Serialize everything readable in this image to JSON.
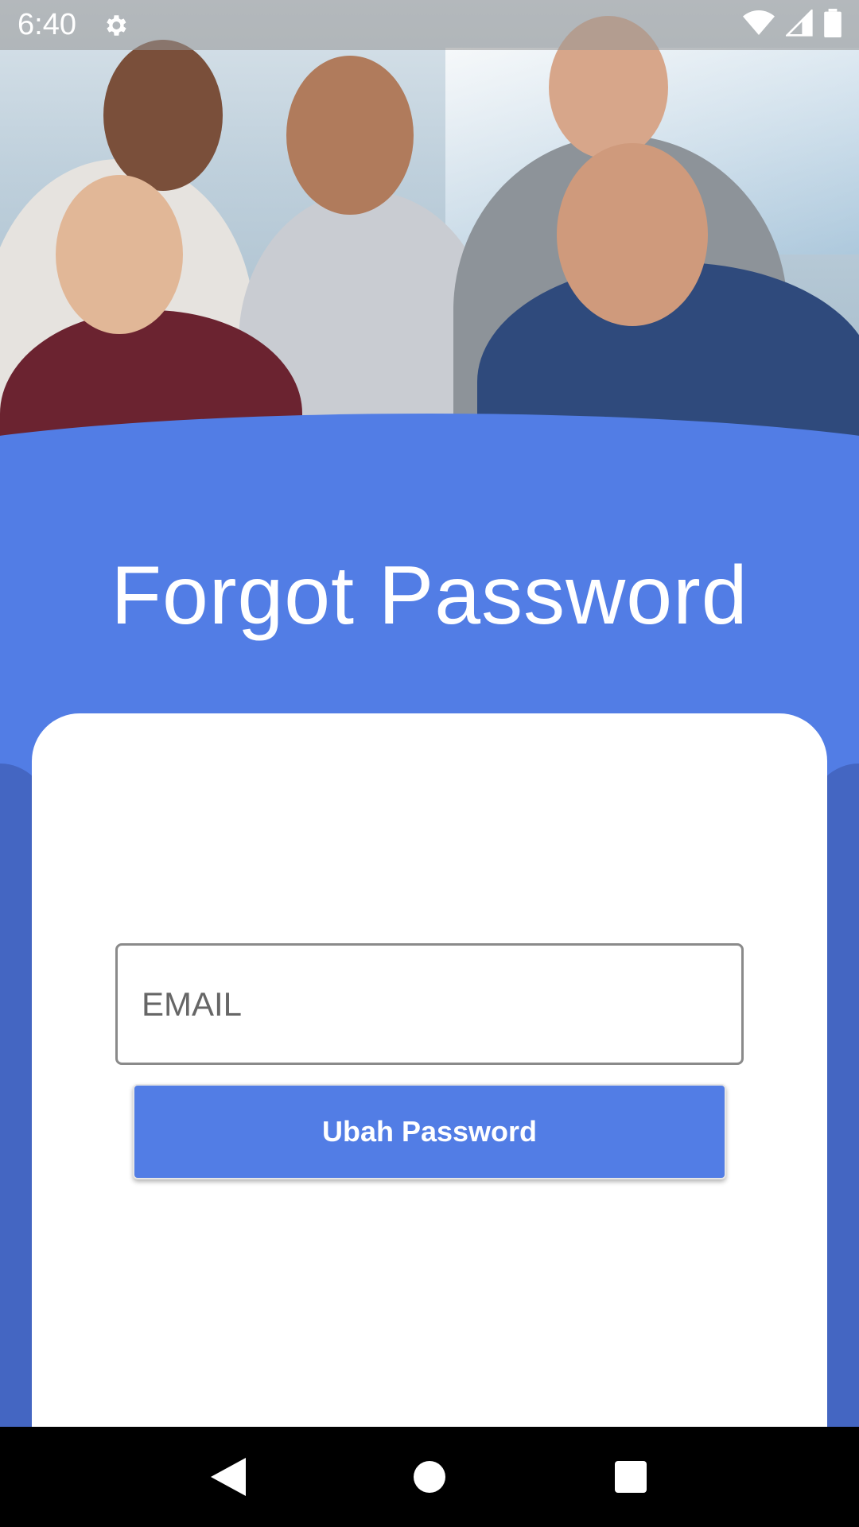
{
  "status_bar": {
    "time": "6:40",
    "icons": [
      "gear-icon",
      "wifi-icon",
      "signal-icon",
      "battery-icon"
    ]
  },
  "hero": {
    "image": "group of five smiling people looking at a laptop"
  },
  "page": {
    "title": "Forgot Password"
  },
  "form": {
    "email_placeholder": "EMAIL",
    "email_value": "",
    "submit_label": "Ubah Password"
  },
  "nav_bar": {
    "icons": [
      "back-icon",
      "home-icon",
      "recents-icon"
    ]
  },
  "colors": {
    "primary": "#527DE5",
    "primary_dark": "#4466C2",
    "card": "#FFFFFF",
    "nav": "#000000"
  }
}
